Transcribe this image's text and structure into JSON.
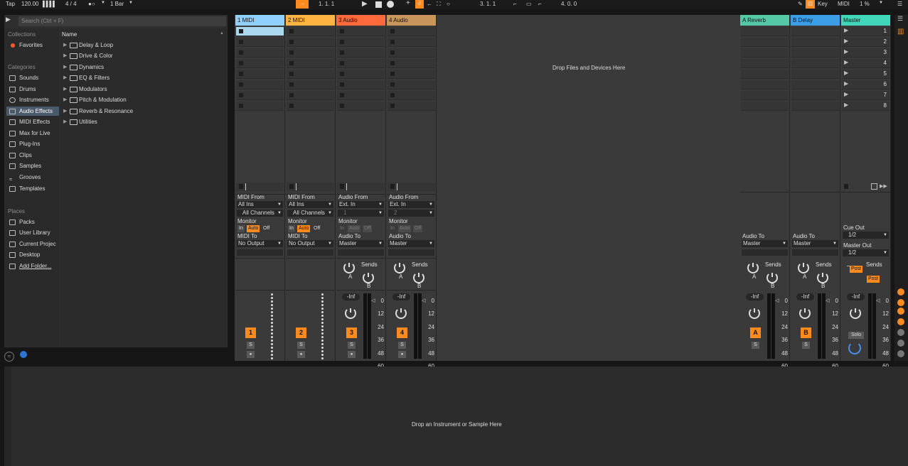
{
  "transport": {
    "tap_label": "Tap",
    "tempo": "120.00",
    "time_sig": "4 / 4",
    "metronome": "●○",
    "quantize": "1 Bar",
    "position": "1.   1.   1",
    "loop_start": "3.   1.   1",
    "loop_length": "4.   0.   0",
    "key_label": "Key",
    "midi_label": "MIDI",
    "cpu": "1 %"
  },
  "browser": {
    "search_placeholder": "Search (Ctrl + F)",
    "collections_header": "Collections",
    "favorites": "Favorites",
    "categories_header": "Categories",
    "categories": [
      "Sounds",
      "Drums",
      "Instruments",
      "Audio Effects",
      "MIDI Effects",
      "Max for Live",
      "Plug-Ins",
      "Clips",
      "Samples",
      "Grooves",
      "Templates"
    ],
    "places_header": "Places",
    "places": [
      "Packs",
      "User Library",
      "Current Projec",
      "Desktop",
      "Add Folder..."
    ],
    "name_header": "Name",
    "items": [
      "Delay & Loop",
      "Drive & Color",
      "Dynamics",
      "EQ & Filters",
      "Modulators",
      "Pitch & Modulation",
      "Reverb & Resonance",
      "Utilities"
    ]
  },
  "tracks": [
    {
      "name": "1 MIDI",
      "color": "#8fd0ff",
      "from_label": "MIDI From",
      "from": "All Ins",
      "channel": "All Channels",
      "monitor_label": "Monitor",
      "mon_in": "In",
      "mon_auto": "Auto",
      "mon_off": "Off",
      "to_label": "MIDI To",
      "to": "No Output",
      "number": "1",
      "solo": "S"
    },
    {
      "name": "2 MIDI",
      "color": "#ffb341",
      "from_label": "MIDI From",
      "from": "All Ins",
      "channel": "All Channels",
      "monitor_label": "Monitor",
      "mon_in": "In",
      "mon_auto": "Auto",
      "mon_off": "Off",
      "to_label": "MIDI To",
      "to": "No Output",
      "number": "2",
      "solo": "S"
    },
    {
      "name": "3 Audio",
      "color": "#ff6a3d",
      "from_label": "Audio From",
      "from": "Ext. In",
      "channel": "1",
      "monitor_label": "Monitor",
      "mon_in": "In",
      "mon_auto": "Auto",
      "mon_off": "Off",
      "to_label": "Audio To",
      "to": "Master",
      "number": "3",
      "solo": "S",
      "sends": "Sends",
      "send_a": "A",
      "send_b": "B",
      "vol": "-Inf"
    },
    {
      "name": "4 Audio",
      "color": "#c8955a",
      "from_label": "Audio From",
      "from": "Ext. In",
      "channel": "2",
      "monitor_label": "Monitor",
      "mon_in": "In",
      "mon_auto": "Auto",
      "mon_off": "Off",
      "to_label": "Audio To",
      "to": "Master",
      "number": "4",
      "solo": "S",
      "sends": "Sends",
      "send_a": "A",
      "send_b": "B",
      "vol": "-Inf"
    }
  ],
  "returns": [
    {
      "name": "A Reverb",
      "color": "#55c8a8",
      "to_label": "Audio To",
      "to": "Master",
      "sends": "Sends",
      "send_a": "A",
      "send_b": "B",
      "vol": "-Inf",
      "letter": "A",
      "solo": "S"
    },
    {
      "name": "B Delay",
      "color": "#3d9ee8",
      "to_label": "Audio To",
      "to": "Master",
      "sends": "Sends",
      "send_a": "A",
      "send_b": "B",
      "vol": "-Inf",
      "letter": "B",
      "solo": "S"
    }
  ],
  "master": {
    "name": "Master",
    "color": "#40d8b8",
    "cue_label": "Cue Out",
    "cue": "1/2",
    "out_label": "Master Out",
    "out": "1/2",
    "sends": "Sends",
    "post1": "Post",
    "post2": "Post",
    "vol": "-Inf",
    "solo": "Solo",
    "scenes": [
      "1",
      "2",
      "3",
      "4",
      "5",
      "6",
      "7",
      "8"
    ]
  },
  "meter_scale": [
    "0",
    "12",
    "24",
    "36",
    "48",
    "60"
  ],
  "drop_files": "Drop Files and Devices Here",
  "drop_instrument": "Drop an Instrument or Sample Here"
}
